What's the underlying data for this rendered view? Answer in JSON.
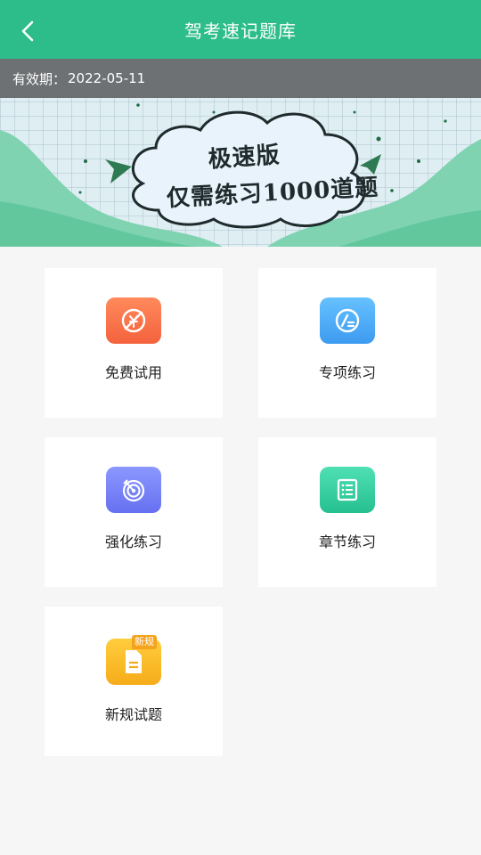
{
  "header": {
    "title": "驾考速记题库"
  },
  "banner": {
    "validity_label": "有效期：",
    "validity_date": "2022-05-11",
    "slogan_line1": "极速版",
    "slogan_line2": "仅需练习1000道题"
  },
  "menu": {
    "items": [
      {
        "label": "免费试用",
        "icon": "free-trial-icon",
        "color_from": "#ff8a5c",
        "color_to": "#f4623d"
      },
      {
        "label": "专项练习",
        "icon": "special-practice-icon",
        "color_from": "#66c1ff",
        "color_to": "#3d9bf0"
      },
      {
        "label": "强化练习",
        "icon": "target-icon",
        "color_from": "#8b98ff",
        "color_to": "#6670f0"
      },
      {
        "label": "章节练习",
        "icon": "list-icon",
        "color_from": "#4fe0b4",
        "color_to": "#26c08f"
      },
      {
        "label": "新规试题",
        "icon": "document-icon",
        "color_from": "#ffcd3c",
        "color_to": "#f6ac1a",
        "badge": "新规"
      }
    ]
  },
  "colors": {
    "header_bg": "#2dbd8a",
    "page_bg": "#f5f6f5"
  }
}
